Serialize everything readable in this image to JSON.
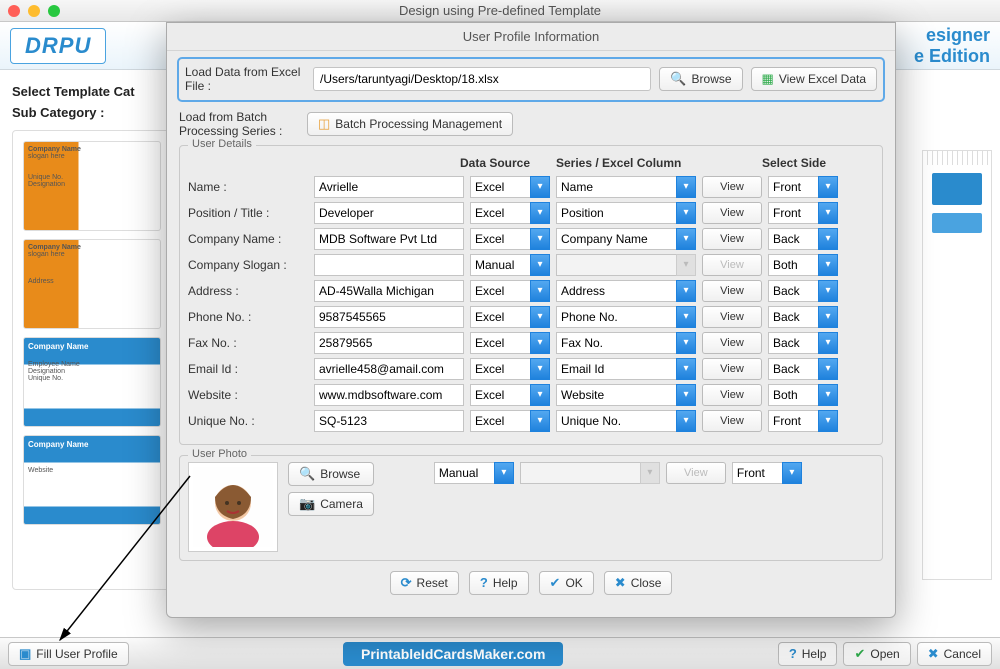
{
  "window": {
    "title": "Design using Pre-defined Template"
  },
  "brand": {
    "logo": "DRPU",
    "right_line1": "esigner",
    "right_line2": "e Edition"
  },
  "main": {
    "select_template": "Select Template Cat",
    "sub_category": "Sub Category :"
  },
  "modal": {
    "title": "User Profile Information",
    "load_label": "Load Data from Excel File :",
    "load_value": "/Users/taruntyagi/Desktop/18.xlsx",
    "browse": "Browse",
    "view_excel": "View Excel Data",
    "batch_label": "Load from Batch Processing Series :",
    "batch_btn": "Batch Processing Management",
    "details_legend": "User Details",
    "headers": {
      "ds": "Data Source",
      "col": "Series / Excel Column",
      "side": "Select Side"
    },
    "rows": [
      {
        "label": "Name :",
        "value": "Avrielle",
        "ds": "Excel",
        "col": "Name",
        "side": "Front",
        "view": true
      },
      {
        "label": "Position / Title :",
        "value": "Developer",
        "ds": "Excel",
        "col": "Position",
        "side": "Front",
        "view": true
      },
      {
        "label": "Company Name :",
        "value": "MDB Software Pvt Ltd",
        "ds": "Excel",
        "col": "Company Name",
        "side": "Back",
        "view": true
      },
      {
        "label": "Company Slogan :",
        "value": "",
        "ds": "Manual",
        "col": "",
        "side": "Both",
        "view": false
      },
      {
        "label": "Address :",
        "value": "AD-45Walla Michigan",
        "ds": "Excel",
        "col": "Address",
        "side": "Back",
        "view": true
      },
      {
        "label": "Phone No. :",
        "value": "9587545565",
        "ds": "Excel",
        "col": "Phone No.",
        "side": "Back",
        "view": true
      },
      {
        "label": "Fax No. :",
        "value": "25879565",
        "ds": "Excel",
        "col": "Fax No.",
        "side": "Back",
        "view": true
      },
      {
        "label": "Email Id :",
        "value": "avrielle458@amail.com",
        "ds": "Excel",
        "col": "Email Id",
        "side": "Back",
        "view": true
      },
      {
        "label": "Website :",
        "value": "www.mdbsoftware.com",
        "ds": "Excel",
        "col": "Website",
        "side": "Both",
        "view": true
      },
      {
        "label": "Unique No. :",
        "value": "SQ-5123",
        "ds": "Excel",
        "col": "Unique No.",
        "side": "Front",
        "view": true
      }
    ],
    "photo_legend": "User Photo",
    "photo_browse": "Browse",
    "photo_camera": "Camera",
    "photo_ds": "Manual",
    "photo_side": "Front",
    "footer": {
      "reset": "Reset",
      "help": "Help",
      "ok": "OK",
      "close": "Close"
    }
  },
  "footer": {
    "fill": "Fill User Profile",
    "watermark": "PrintableIdCardsMaker.com",
    "help": "Help",
    "open": "Open",
    "cancel": "Cancel"
  },
  "tpl": {
    "company": "Company Name",
    "slogan": "slogan here",
    "emp": "Employee Name",
    "desig": "Designation",
    "unique": "Unique No.",
    "addr": "Address",
    "website": "Website"
  }
}
